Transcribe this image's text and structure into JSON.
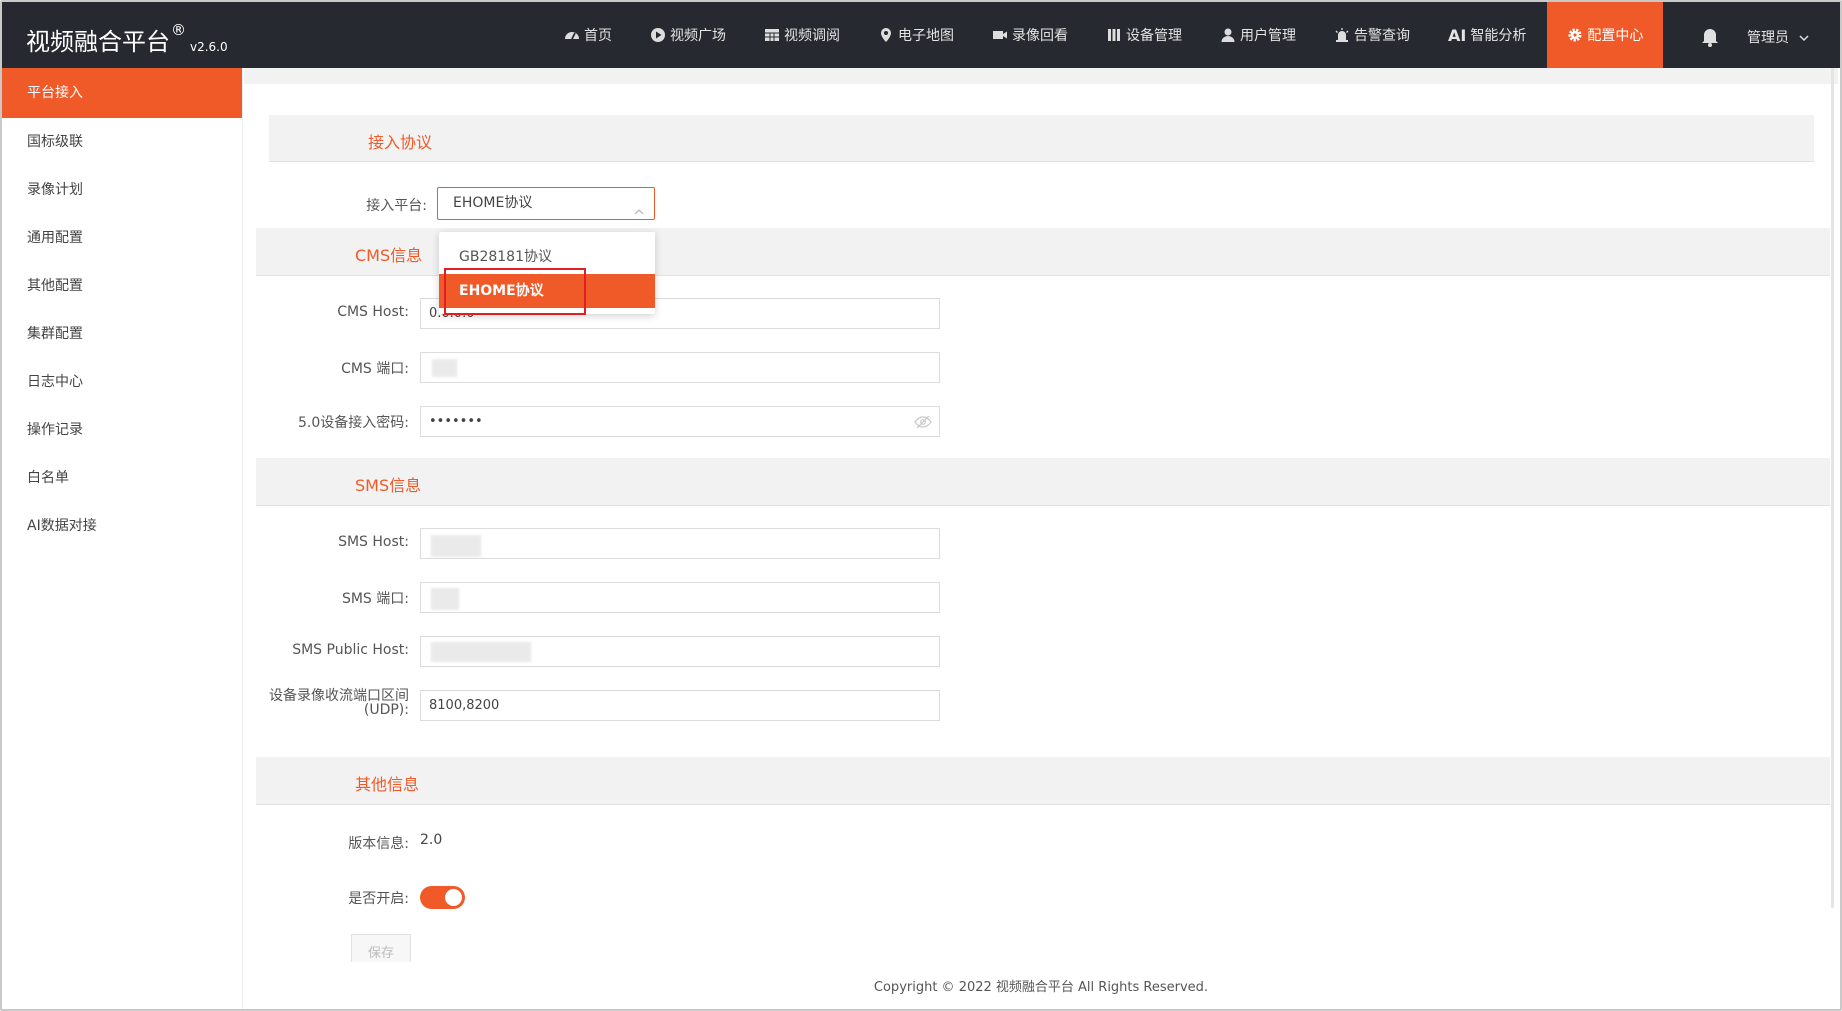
{
  "app": {
    "title": "视频融合平台",
    "registered": "®",
    "version": "v2.6.0"
  },
  "nav": {
    "items": [
      {
        "label": "首页",
        "icon": "dashboard-icon"
      },
      {
        "label": "视频广场",
        "icon": "play-circle-icon"
      },
      {
        "label": "视频调阅",
        "icon": "grid-icon"
      },
      {
        "label": "电子地图",
        "icon": "map-pin-icon"
      },
      {
        "label": "录像回看",
        "icon": "video-camera-icon"
      },
      {
        "label": "设备管理",
        "icon": "device-icon"
      },
      {
        "label": "用户管理",
        "icon": "user-icon"
      },
      {
        "label": "告警查询",
        "icon": "alarm-icon"
      },
      {
        "label": "智能分析",
        "icon": "ai-icon",
        "prefix": "AI"
      },
      {
        "label": "配置中心",
        "icon": "gear-icon",
        "active": true
      }
    ],
    "user": "管理员",
    "accent": "#f05a28",
    "bar_color": "#262a30"
  },
  "sidebar": {
    "items": [
      {
        "label": "平台接入",
        "active": true
      },
      {
        "label": "国标级联"
      },
      {
        "label": "录像计划"
      },
      {
        "label": "通用配置"
      },
      {
        "label": "其他配置"
      },
      {
        "label": "集群配置"
      },
      {
        "label": "日志中心"
      },
      {
        "label": "操作记录"
      },
      {
        "label": "白名单"
      },
      {
        "label": "AI数据对接"
      }
    ]
  },
  "sections": {
    "protocol": "接入协议",
    "cms": "CMS信息",
    "sms": "SMS信息",
    "other": "其他信息"
  },
  "form": {
    "platform_label": "接入平台:",
    "platform_value": "EHOME协议",
    "platform_options": [
      "GB28181协议",
      "EHOME协议"
    ],
    "cms_host_label": "CMS Host:",
    "cms_host_value": "0.0.0.0",
    "cms_port_label": "CMS 端口:",
    "password_label": "5.0设备接入密码:",
    "password_value": "•••••••",
    "sms_host_label": "SMS Host:",
    "sms_port_label": "SMS 端口:",
    "sms_public_host_label": "SMS Public Host:",
    "udp_label_line1": "设备录像收流端口区间",
    "udp_label_line2": "(UDP):",
    "udp_value": "8100,8200",
    "version_label": "版本信息:",
    "version_value": "2.0",
    "enabled_label": "是否开启:",
    "enabled": true,
    "save_label": "保存"
  },
  "footer": {
    "copyright": "Copyright © 2022 视频融合平台 All Rights Reserved."
  }
}
